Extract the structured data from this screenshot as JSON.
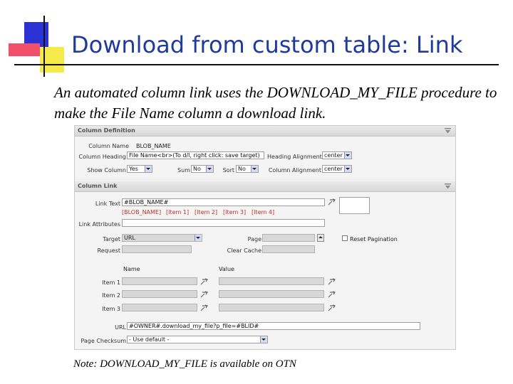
{
  "slide": {
    "title": "Download from custom table: Link",
    "subtitle": "An automated column link uses the DOWNLOAD_MY_FILE procedure to make the File Name column a download link.",
    "note": "Note: DOWNLOAD_MY_FILE is available on OTN"
  },
  "column_definition": {
    "title": "Column Definition",
    "column_name_label": "Column Name",
    "column_name_value": "BLOB_NAME",
    "column_heading_label": "Column Heading",
    "column_heading_value": "File Name<br>(To d/l, right click: save target)",
    "heading_alignment_label": "Heading Alignment",
    "heading_alignment_value": "center",
    "show_column_label": "Show Column",
    "show_column_value": "Yes",
    "sum_label": "Sum",
    "sum_value": "No",
    "sort_label": "Sort",
    "sort_value": "No",
    "column_alignment_label": "Column Alignment",
    "column_alignment_value": "center"
  },
  "column_link": {
    "title": "Column Link",
    "link_text_label": "Link Text",
    "link_text_value": "#BLOB_NAME#",
    "substitutions": [
      "[BLOB_NAME]",
      "[Item 1]",
      "[Item 2]",
      "[Item 3]",
      "[Item 4]"
    ],
    "link_attributes_label": "Link Attributes",
    "link_attributes_value": "",
    "target_label": "Target",
    "target_value": "URL",
    "page_label": "Page",
    "page_value": "",
    "reset_pagination_label": "Reset Pagination",
    "request_label": "Request",
    "request_value": "",
    "clear_cache_label": "Clear Cache",
    "clear_cache_value": "",
    "name_header": "Name",
    "value_header": "Value",
    "item1_label": "Item 1",
    "item2_label": "Item 2",
    "item3_label": "Item 3",
    "url_label": "URL",
    "url_value": "#OWNER#.download_my_file?p_file=#BLID#",
    "page_checksum_label": "Page Checksum",
    "page_checksum_value": "- Use default -"
  },
  "colors": {
    "title": "#1d3a9c",
    "deco_blue": "#2a32d6",
    "deco_red": "#f2506a",
    "deco_yellow": "#f6e94a",
    "link_red": "#c0302a"
  },
  "icons": [
    "hide-region-icon",
    "list-of-values-icon",
    "spin-arrow-icon"
  ]
}
